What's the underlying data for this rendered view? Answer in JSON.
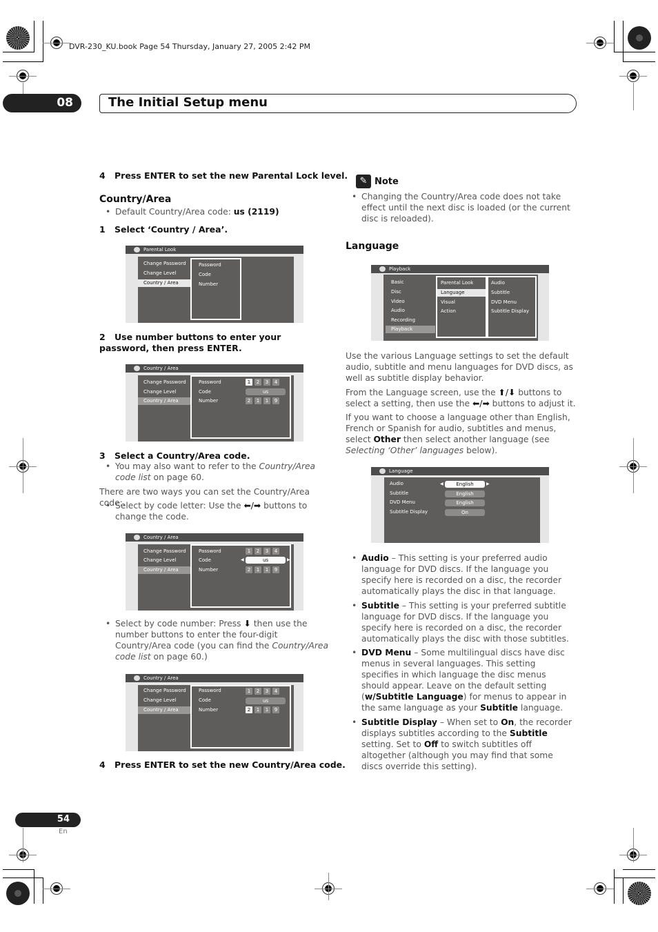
{
  "print_header": "DVR-230_KU.book  Page 54  Thursday, January 27, 2005  2:42 PM",
  "chapter": {
    "number": "08",
    "title": "The Initial Setup menu"
  },
  "left": {
    "step4_parental": {
      "num": "4",
      "text": "Press ENTER to set the new Parental Lock level."
    },
    "heading": "Country/Area",
    "default_bullet": {
      "prefix": "Default Country/Area code: ",
      "value": "us (2119)"
    },
    "step1": {
      "num": "1",
      "text": "Select ‘Country / Area’."
    },
    "step2": {
      "num": "2",
      "text": "Use number buttons to enter your password, then press ENTER."
    },
    "step3": {
      "num": "3",
      "text": "Select a Country/Area code."
    },
    "step3_bullet": {
      "text": "You may also want to refer to the ",
      "ref": "Country/Area code list",
      "suffix": " on page 60."
    },
    "two_ways": "There are two ways you can set the Country/Area code:.",
    "letter_bullet": {
      "prefix": "Select by code letter: Use the ",
      "arrows": "⬅/➡",
      "suffix": " buttons to change the code."
    },
    "number_bullet": {
      "prefix": "Select by code number: Press ",
      "arrow": "⬇",
      "mid": " then use the number buttons to enter the four-digit Country/Area code (you can find the ",
      "ref": "Country/Area code list",
      "suffix": " on page 60.)"
    },
    "step4_country": {
      "num": "4",
      "text": "Press ENTER to set the new Country/Area code."
    }
  },
  "screens": {
    "parental": {
      "title": "Parental Look",
      "menu": [
        "Change Password",
        "Change Level",
        "Country / Area"
      ],
      "fields": [
        "Password",
        "Code",
        "Number"
      ]
    },
    "country_pw": {
      "title": "Country / Area",
      "menu": [
        "Change Password",
        "Change Level",
        "Country / Area"
      ],
      "fields": [
        "Password",
        "Code",
        "Number"
      ],
      "password": [
        "1",
        "2",
        "3",
        "4"
      ],
      "code": "us",
      "number": [
        "2",
        "1",
        "1",
        "9"
      ]
    },
    "country_code": {
      "title": "Country / Area",
      "menu": [
        "Change Password",
        "Change Level",
        "Country / Area"
      ],
      "fields": [
        "Password",
        "Code",
        "Number"
      ],
      "password": [
        "1",
        "2",
        "3",
        "4"
      ],
      "code": "us",
      "number": [
        "2",
        "1",
        "1",
        "9"
      ]
    },
    "country_num": {
      "title": "Country / Area",
      "menu": [
        "Change Password",
        "Change Level",
        "Country / Area"
      ],
      "fields": [
        "Password",
        "Code",
        "Number"
      ],
      "password": [
        "1",
        "2",
        "3",
        "4"
      ],
      "code": "us",
      "number": [
        "2",
        "1",
        "1",
        "9"
      ]
    },
    "playback": {
      "title": "Playback",
      "menu": [
        "Basic",
        "Disc",
        "Video",
        "Audio",
        "Recording",
        "Playback"
      ],
      "sub": [
        "Parental Look",
        "Language",
        "Visual",
        "Action"
      ],
      "options": [
        "Audio",
        "Subtitle",
        "DVD Menu",
        "Subtitle Display"
      ]
    },
    "language": {
      "title": "Language",
      "rows": [
        {
          "label": "Audio",
          "value": "English"
        },
        {
          "label": "Subtitle",
          "value": "English"
        },
        {
          "label": "DVD Menu",
          "value": "English"
        },
        {
          "label": "Subtitle Display",
          "value": "On"
        }
      ]
    }
  },
  "right": {
    "note_icon": "✎",
    "note_title": "Note",
    "note_text": "Changing the Country/Area code does not take effect until the next disc is loaded (or the current disc is reloaded).",
    "heading": "Language",
    "p1": "Use the various Language settings to set the default audio, subtitle and menu languages for DVD discs, as well as subtitle display behavior.",
    "p2": {
      "a": "From the Language screen, use the ",
      "ud": "⬆/⬇",
      "b": " buttons to select a setting, then use the ",
      "lr": "⬅/➡",
      "c": " buttons to adjust it."
    },
    "p3": {
      "a": "If you want to choose a language other than English, French or Spanish for audio, subtitles and menus, select ",
      "bold": "Other",
      "b": " then select another language (see ",
      "ref": "Selecting ‘Other’ languages",
      "c": " below)."
    },
    "bullets": {
      "audio": {
        "term": "Audio",
        "text": " – This setting is your preferred audio language for DVD discs. If the language you specify here is recorded on a disc, the recorder automatically plays the disc in that language."
      },
      "subtitle": {
        "term": "Subtitle",
        "text": " – This setting is your preferred subtitle language for DVD discs. If the language you specify here is recorded on a disc, the recorder automatically plays the disc with those subtitles."
      },
      "dvdmenu": {
        "term": "DVD Menu",
        "a": " – Some multilingual discs have disc menus in several languages. This setting specifies in which language the disc menus should appear. Leave on the default setting (",
        "b1": "w/Subtitle Language",
        "b": ") for menus to appear in the same language as your ",
        "b2": "Subtitle",
        "c": " language."
      },
      "display": {
        "term": "Subtitle Display",
        "a": " – When set to ",
        "b1": "On",
        "b": ", the recorder displays subtitles according to the ",
        "b2": "Subtitle",
        "c": " setting. Set to ",
        "b3": "Off",
        "d": " to switch subtitles off altogether (although you may find that some discs override this setting)."
      }
    }
  },
  "footer": {
    "page": "54",
    "lang": "En"
  }
}
